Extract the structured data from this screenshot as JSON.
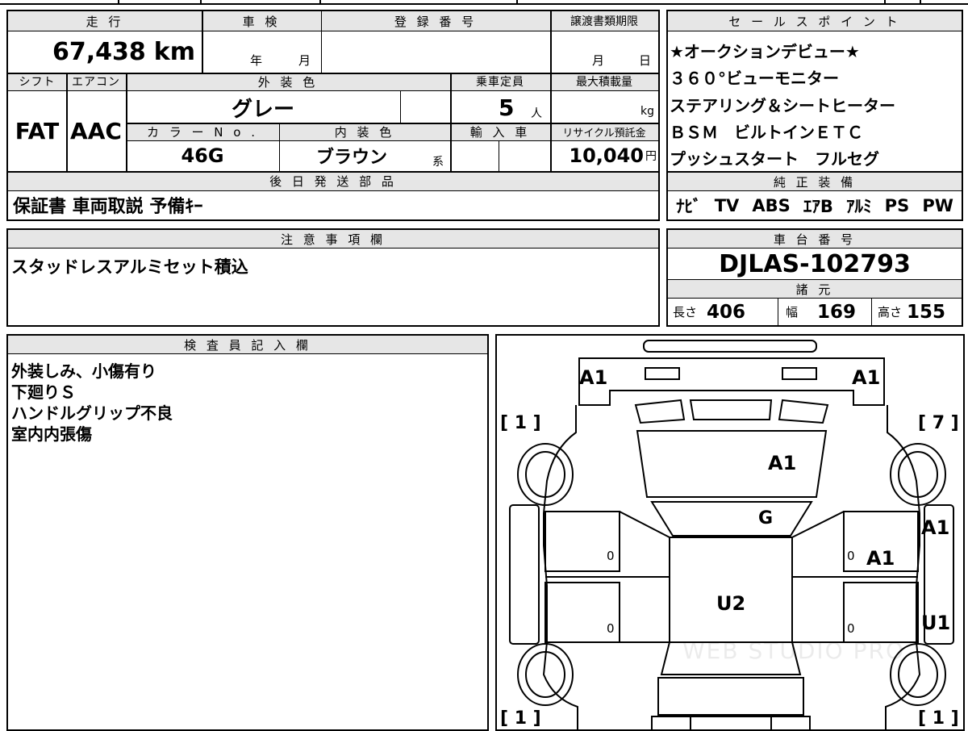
{
  "top_panel": {
    "headers": {
      "mileage": "走 行",
      "shaken": "車 検",
      "registration": "登 録 番 号",
      "transfer_deadline": "譲渡書類期限",
      "shift": "シフト",
      "aircon": "エアコン",
      "exterior_color": "外 装 色",
      "capacity": "乗車定員",
      "max_load": "最大積載量",
      "color_no": "カ ラ ー N o .",
      "interior_color": "内 装 色",
      "import": "輸 入 車",
      "recycle_fee": "リサイクル預託金",
      "later_parts": "後 日 発 送 部 品"
    },
    "values": {
      "mileage": "67,438",
      "mileage_unit": "km",
      "shaken_year": "年",
      "shaken_month": "月",
      "transfer_month": "月",
      "transfer_day": "日",
      "shift": "FAT",
      "aircon": "AAC",
      "exterior_color": "グレー",
      "capacity": "5",
      "capacity_unit": "人",
      "max_load_unit": "kg",
      "color_no": "46G",
      "interior_color": "ブラウン",
      "interior_suffix": "系",
      "recycle_fee": "10,040",
      "recycle_unit": "円",
      "later_parts": "保証書 車両取説 予備ｷｰ"
    }
  },
  "sales_points": {
    "header": "セ ー ル ス ポ イ ン ト",
    "lines": [
      "★オークションデビュー★",
      "３６０°ビューモニター",
      "ステアリング＆シートヒーター",
      "ＢＳＭ　ビルトインＥＴＣ",
      "プッシュスタート　フルセグ"
    ]
  },
  "equipment": {
    "header": "純 正 装 備",
    "items": [
      "ﾅﾋﾞ",
      "TV",
      "ABS",
      "ｴｱB",
      "ｱﾙﾐ",
      "PS",
      "PW"
    ]
  },
  "notes": {
    "header": "注 意 事 項 欄",
    "text": "スタッドレスアルミセット積込"
  },
  "chassis": {
    "header": "車 台 番 号",
    "number": "DJLAS-102793"
  },
  "specs": {
    "header": "諸 元",
    "length_label": "長さ",
    "length": "406",
    "width_label": "幅",
    "width": "169",
    "height_label": "高さ",
    "height": "155"
  },
  "inspector": {
    "header": "検 査 員 記 入 欄",
    "lines": [
      "外装しみ、小傷有り",
      "下廻りＳ",
      "ハンドルグリップ不良",
      "室内内張傷"
    ]
  },
  "diagram": {
    "tire_front_left": "[ 1 ]",
    "tire_front_right": "[ 7 ]",
    "tire_rear_left": "[ 1 ]",
    "tire_rear_right": "[ 1 ]",
    "marks": {
      "bumper_left": "A1",
      "bumper_right": "A1",
      "hood": "A1",
      "windshield": "G",
      "front_right_door_side": "A1",
      "front_right_door": "A1",
      "roof": "U2",
      "rear_right_side": "U1",
      "door_fl": "0",
      "door_rl": "0",
      "door_fr": "0",
      "door_rr": "0"
    },
    "watermark": "WEB STUDIO PRO"
  }
}
